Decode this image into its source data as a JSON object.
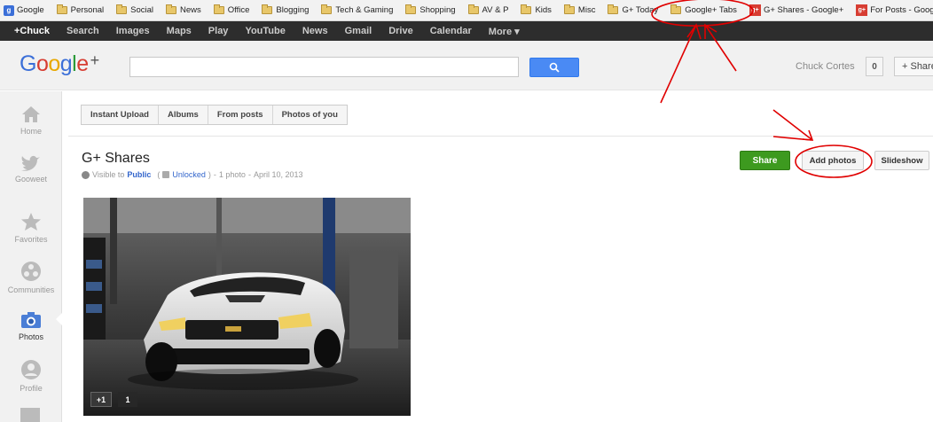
{
  "bookmarks": {
    "items": [
      {
        "label": "Google",
        "icon": "google-icon"
      },
      {
        "label": "Personal",
        "icon": "folder-icon"
      },
      {
        "label": "Social",
        "icon": "folder-icon"
      },
      {
        "label": "News",
        "icon": "folder-icon"
      },
      {
        "label": "Office",
        "icon": "folder-icon"
      },
      {
        "label": "Blogging",
        "icon": "folder-icon"
      },
      {
        "label": "Tech & Gaming",
        "icon": "folder-icon"
      },
      {
        "label": "Shopping",
        "icon": "folder-icon"
      },
      {
        "label": "AV & P",
        "icon": "folder-icon"
      },
      {
        "label": "Kids",
        "icon": "folder-icon"
      },
      {
        "label": "Misc",
        "icon": "folder-icon"
      },
      {
        "label": "G+ Today",
        "icon": "folder-icon"
      },
      {
        "label": "Google+ Tabs",
        "icon": "folder-icon"
      },
      {
        "label": "G+ Shares - Google+",
        "icon": "gplus-icon"
      },
      {
        "label": "For Posts - Google+",
        "icon": "gplus-icon"
      }
    ],
    "more": "»"
  },
  "gbar": {
    "items": [
      "+Chuck",
      "Search",
      "Images",
      "Maps",
      "Play",
      "YouTube",
      "News",
      "Gmail",
      "Drive",
      "Calendar",
      "More ▾"
    ]
  },
  "header": {
    "logo_letters": [
      "G",
      "o",
      "o",
      "g",
      "l",
      "e"
    ],
    "logo_plus": "+",
    "search_placeholder": "",
    "user_name": "Chuck Cortes",
    "notification_count": "0",
    "share_label": "+ Share"
  },
  "leftnav": {
    "items": [
      {
        "label": "Home",
        "icon": "home-icon"
      },
      {
        "label": "Gooweet",
        "icon": "bird-icon"
      },
      {
        "label": "Favorites",
        "icon": "star-icon"
      },
      {
        "label": "Communities",
        "icon": "communities-icon"
      },
      {
        "label": "Photos",
        "icon": "camera-icon"
      },
      {
        "label": "Profile",
        "icon": "profile-icon"
      }
    ]
  },
  "subtabs": [
    "Instant Upload",
    "Albums",
    "From posts",
    "Photos of you"
  ],
  "album": {
    "title": "G+ Shares",
    "visible_to": "Visible to",
    "audience": "Public",
    "lock_label": "Unlocked",
    "photo_count": "1 photo",
    "date": "April 10, 2013",
    "sep": "-"
  },
  "actions": {
    "share": "Share",
    "add_photos": "Add photos",
    "slideshow": "Slideshow"
  },
  "photo": {
    "plusone_label": "+1",
    "plusone_count": "1"
  },
  "colors": {
    "share_green": "#3d9a1f",
    "search_blue": "#4a8af4",
    "annotation_red": "#e00000"
  }
}
